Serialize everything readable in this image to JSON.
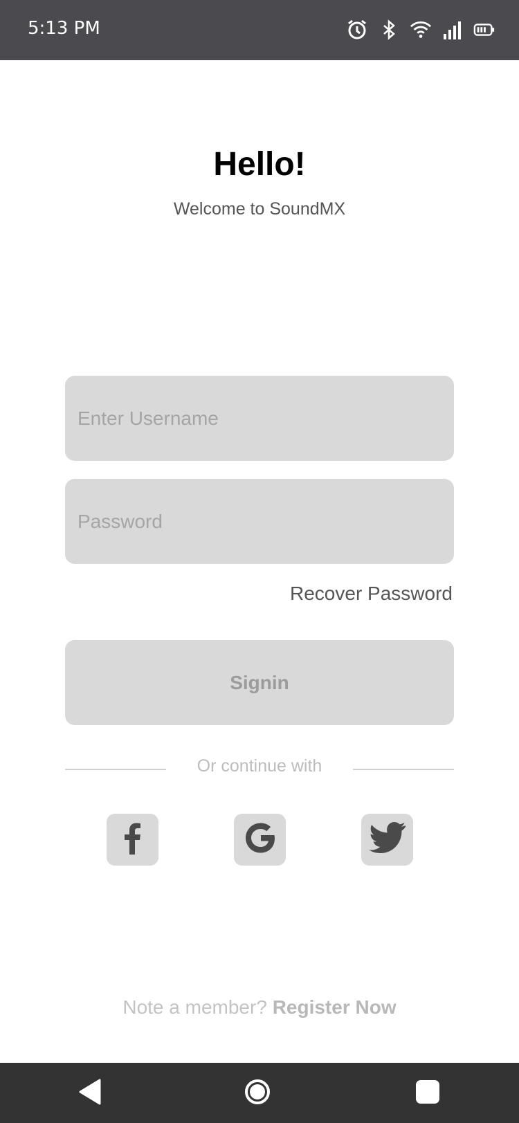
{
  "status_bar": {
    "time": "5:13 PM",
    "icons": [
      "alarm-icon",
      "bluetooth-icon",
      "wifi-icon",
      "signal-icon",
      "battery-icon"
    ]
  },
  "header": {
    "title": "Hello!",
    "subtitle": "Welcome to SoundMX"
  },
  "form": {
    "username_placeholder": "Enter Username",
    "password_placeholder": "Password",
    "recover_label": "Recover Password",
    "signin_label": "Signin"
  },
  "social": {
    "divider_text": "Or continue with",
    "providers": [
      "facebook-icon",
      "google-icon",
      "twitter-icon"
    ]
  },
  "footer": {
    "prompt": "Note a member? ",
    "register_label": "Register Now"
  },
  "nav": {
    "icons": [
      "back-icon",
      "home-icon",
      "recents-icon"
    ]
  },
  "colors": {
    "status_bar": "#4b4a4f",
    "field_bg": "#d9d9d9",
    "nav_bar": "#333333"
  }
}
